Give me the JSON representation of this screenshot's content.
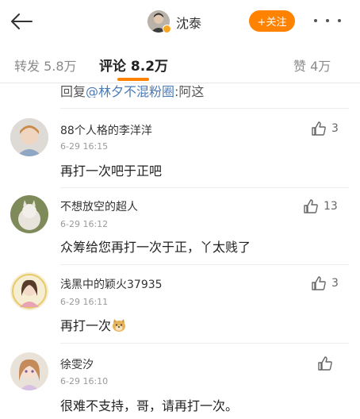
{
  "header": {
    "user_name": "沈泰",
    "follow_label": "+关注"
  },
  "tabs": [
    {
      "label": "转发 5.8万"
    },
    {
      "label": "评论 8.2万"
    },
    {
      "label": "赞 4万"
    }
  ],
  "reply_preview": {
    "prefix": "回复",
    "mention": "@林夕不混粉圈",
    "suffix": ":阿这"
  },
  "comments": [
    {
      "name": "88个人格的李洋洋",
      "time": "6-29 16:15",
      "text": "再打一次吧于正吧",
      "likes": "3"
    },
    {
      "name": "不想放空的超人",
      "time": "6-29 16:12",
      "text": "众筹给您再打一次于正，丫太贱了",
      "likes": "13"
    },
    {
      "name": "浅黑中的颖火37935",
      "time": "6-29 16:11",
      "text": "再打一次",
      "likes": "3"
    },
    {
      "name": "徐雯汐",
      "time": "6-29 16:10",
      "text": "很难不支持，哥，请再打一次。",
      "likes": ""
    }
  ],
  "colors": {
    "accent": "#ff8200",
    "mention": "#4a7bb7"
  }
}
